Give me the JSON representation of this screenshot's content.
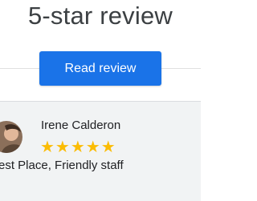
{
  "headline": "5-star review",
  "button": {
    "label": "Read review"
  },
  "review": {
    "name": "Irene Calderon",
    "rating": 5,
    "stars_text": "★★★★★",
    "text": "est Place, Friendly staff"
  },
  "colors": {
    "accent": "#1a73e8",
    "star": "#fbbc04",
    "card_bg": "#f1f3f4"
  }
}
